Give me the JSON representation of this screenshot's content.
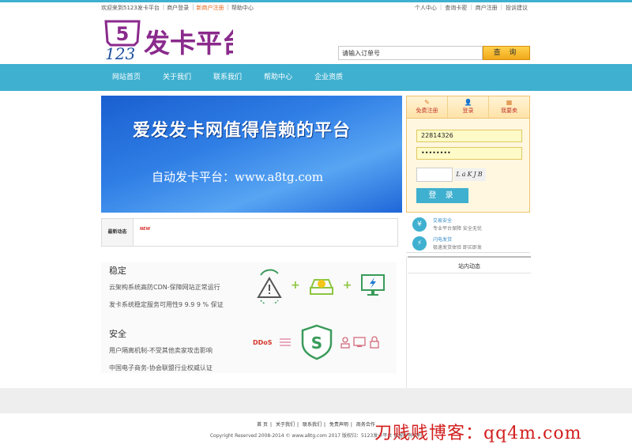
{
  "topbar": {
    "welcome": "欢迎来到5123发卡平台",
    "merchant_login": "商户登录",
    "merchant_register": "新商户注册",
    "help_center": "帮助中心",
    "personal_center": "个人中心",
    "query_card": "查询卡密",
    "merchant_register_right": "商户注册",
    "complaint": "投诉建议"
  },
  "logo": {
    "num_top": "5",
    "num_bottom": "123",
    "text": "发卡平台"
  },
  "search": {
    "placeholder": "请输入订单号",
    "button": "查 询"
  },
  "nav": {
    "items": [
      "网站首页",
      "关于我们",
      "联系我们",
      "帮助中心",
      "企业资质"
    ]
  },
  "banner": {
    "headline": "爱发发卡网值得信赖的平台",
    "sub": "自动发卡平台：www.a8tg.com"
  },
  "news": {
    "label": "最新动态",
    "badge": "NEW"
  },
  "features": {
    "stable": {
      "title": "稳定",
      "line1": "云架构系统高防CDN-保障网站正常运行",
      "line2": "发卡系统稳定服务可用性9 9.9 9 % 保证"
    },
    "secure": {
      "title": "安全",
      "line1": "用户隔离机制-不受其他卖家攻击影响",
      "line2": "中国电子商务-协会联盟行业权威认证"
    },
    "ddos": "DDoS",
    "shield": "S"
  },
  "login": {
    "tabs": [
      {
        "icon": "edit-icon",
        "label": "免费注册"
      },
      {
        "icon": "user-icon",
        "label": "登录"
      },
      {
        "icon": "shop-icon",
        "label": "我要卖"
      }
    ],
    "username": "22814326",
    "password": "••••••••",
    "captcha": "LaKJB",
    "button": "登 录"
  },
  "assure": [
    {
      "icon": "yen-icon",
      "title": "交易安全",
      "desc": "专业平台保障 安全无忧"
    },
    {
      "icon": "lightning-icon",
      "title": "闪电发货",
      "desc": "极速发货体验 即买即发"
    }
  ],
  "sitenews": {
    "title": "站内动态"
  },
  "footer": {
    "links": [
      "首 页",
      "关于我们",
      "联系我们",
      "免责声明",
      "商务合作"
    ],
    "copyright": "Copyright Reserved 2008-2014 © www.a8tg.com    2017 版权归：5123发卡平台 保留所有权利"
  },
  "watermark": "刀贱贱博客：qq4m.com",
  "colors": {
    "accent": "#3fb0cf",
    "orange": "#f0a81a",
    "logo": "#8a2a8c"
  }
}
